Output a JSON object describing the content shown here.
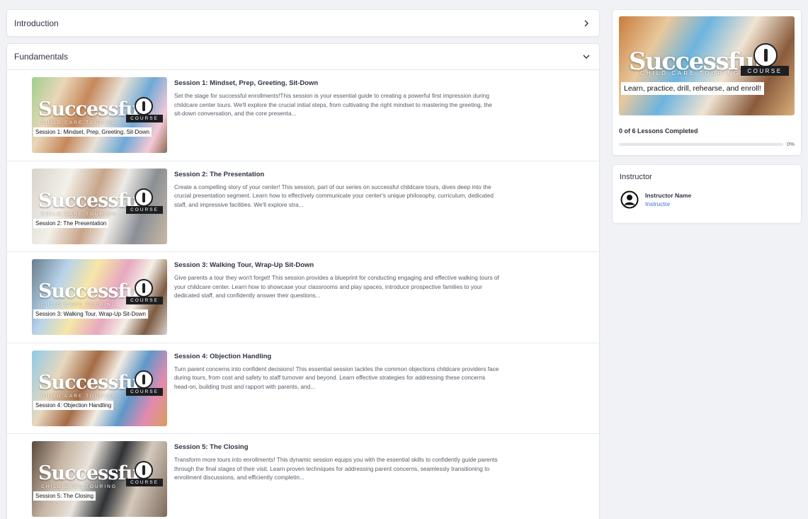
{
  "sections": {
    "introduction": {
      "title": "Introduction"
    },
    "fundamentals": {
      "title": "Fundamentals"
    }
  },
  "thumbnail_brand": {
    "script": "Successful",
    "subtitle": "CHILD CARE TOURING",
    "course": "COURSE"
  },
  "lessons": [
    {
      "caption": "Session 1: Mindset, Prep, Greeting, Sit-Down",
      "title": "Session 1: Mindset, Prep, Greeting, Sit-Down",
      "description": "Set the stage for successful enrollments!This session is your essential guide to creating a powerful first impression during childcare center tours. We'll explore the crucial initial steps, from cultivating the right mindset to mastering the greeting, the sit-down conversation, and the core presenta..."
    },
    {
      "caption": "Session 2: The Presentation",
      "title": "Session 2: The Presentation",
      "description": "Create a compelling story of your center! This session, part of our series on successful childcare tours, dives deep into the crucial presentation segment. Learn how to effectively communicate your center's unique philosophy, curriculum, dedicated staff, and impressive facilities. We'll explore stra..."
    },
    {
      "caption": "Session 3: Walking Tour, Wrap-Up Sit-Down",
      "title": "Session 3: Walking Tour, Wrap-Up Sit-Down",
      "description": "Give parents a tour they won't forget! This session provides a blueprint for conducting engaging and effective walking tours of your childcare center. Learn how to showcase your classrooms and play spaces, introduce prospective families to your dedicated staff, and confidently answer their questions..."
    },
    {
      "caption": "Session 4: Objection Handling",
      "title": "Session 4: Objection Handling",
      "description": "Turn parent concerns into confident decisions! This essential session tackles the common objections childcare providers face during tours, from cost and safety to staff turnover and beyond. Learn effective strategies for addressing these concerns head-on, building trust and rapport with parents, and..."
    },
    {
      "caption": "Session 5: The Closing",
      "title": "Session 5: The Closing",
      "description": "Transform more tours into enrollments! This dynamic session equips you with the essential skills to confidently guide parents through the final stages of their visit. Learn proven techniques for addressing parent concerns, seamlessly transitioning to enrollment discussions, and efficiently completin..."
    }
  ],
  "course_card": {
    "hero_script": "Successful",
    "hero_subtitle": "CHILD CARE TOURING",
    "hero_course": "COURSE",
    "hero_tagline": "Learn, practice, drill, rehearse, and enroll!",
    "progress_label": "0 of 6 Lessons Completed",
    "progress_fraction": 0,
    "progress_pct": "0%"
  },
  "instructor": {
    "heading": "Instructor",
    "name": "Instructor Name",
    "role": "Instructor"
  },
  "colors": {
    "accent": "#3b6fd8",
    "background": "#f1f2f6"
  }
}
